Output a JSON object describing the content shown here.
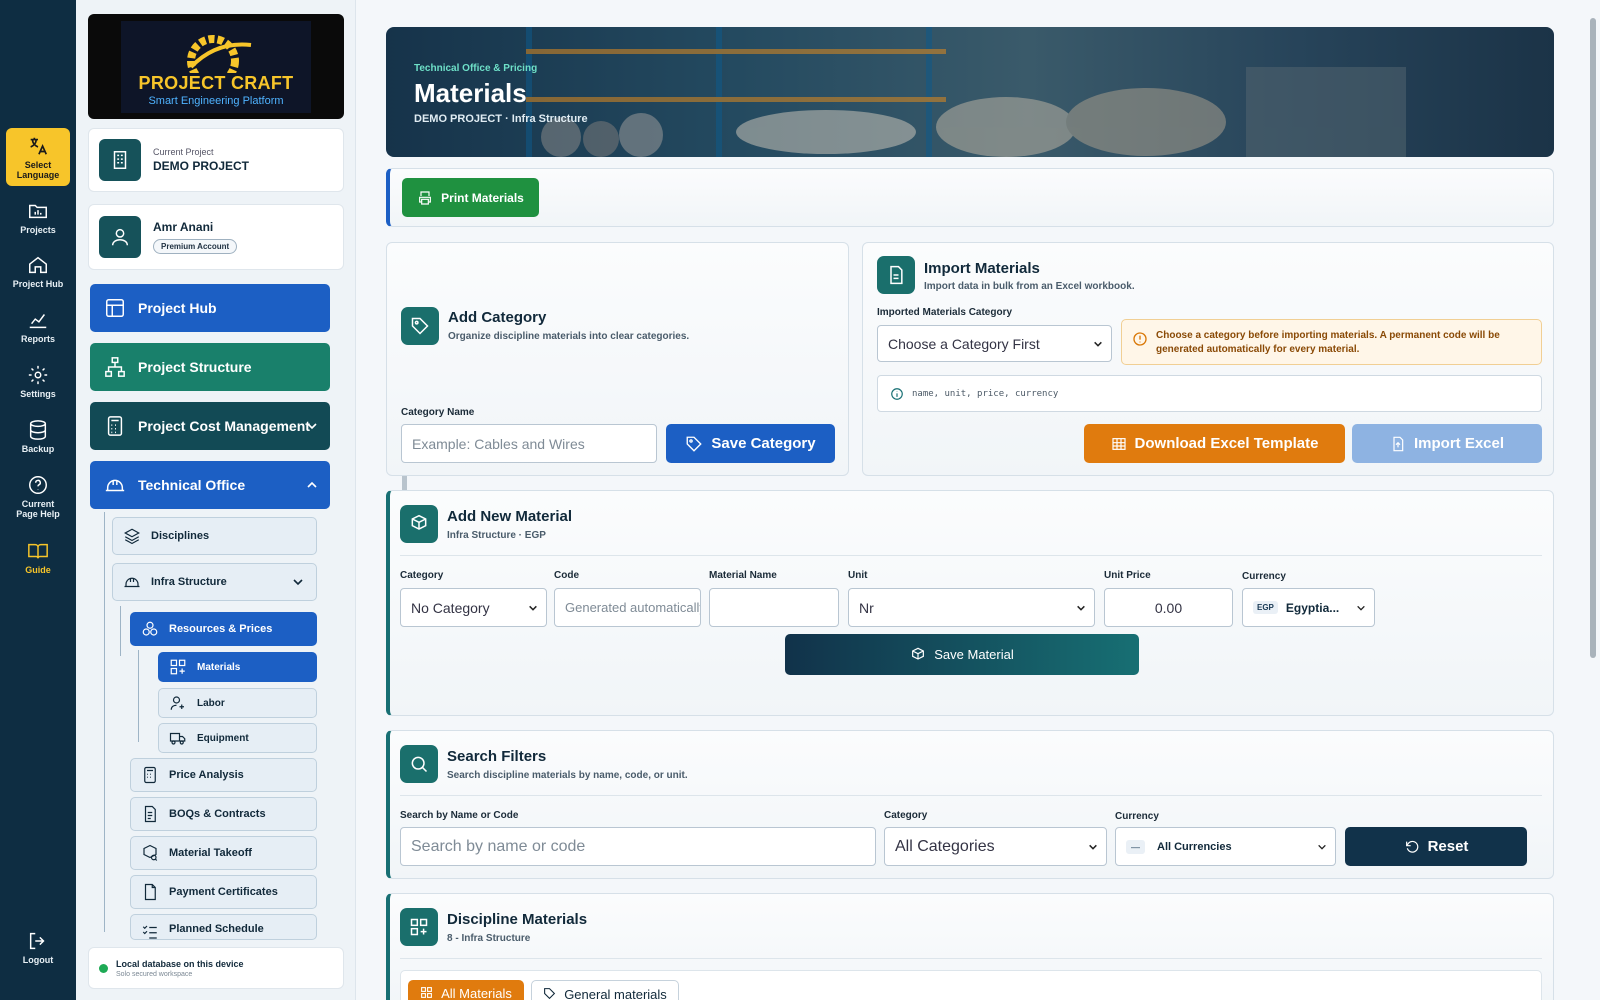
{
  "rail": {
    "language": "Select Language",
    "projects": "Projects",
    "project_hub": "Project Hub",
    "reports": "Reports",
    "settings": "Settings",
    "backup": "Backup",
    "help": "Current Page Help",
    "guide": "Guide",
    "logout": "Logout"
  },
  "logo": {
    "title": "PROJECT CRAFT",
    "subtitle": "Smart Engineering Platform"
  },
  "project_card": {
    "label": "Current Project",
    "name": "DEMO PROJECT"
  },
  "user_card": {
    "name": "Amr Anani",
    "badge": "Premium Account"
  },
  "nav": {
    "project_hub": "Project Hub",
    "project_structure": "Project Structure",
    "cost_management": "Project Cost Management",
    "technical_office": "Technical Office",
    "disciplines": "Disciplines",
    "infra_structure": "Infra Structure",
    "resources_prices": "Resources & Prices",
    "materials": "Materials",
    "labor": "Labor",
    "equipment": "Equipment",
    "price_analysis": "Price Analysis",
    "boqs": "BOQs & Contracts",
    "takeoff": "Material Takeoff",
    "payment": "Payment Certificates",
    "schedule": "Planned Schedule"
  },
  "db": {
    "title": "Local database on this device",
    "subtitle": "Solo secured workspace"
  },
  "hero": {
    "eyebrow": "Technical Office & Pricing",
    "title": "Materials",
    "meta": "DEMO PROJECT · Infra Structure"
  },
  "toolbar": {
    "print": "Print Materials"
  },
  "add_category": {
    "title": "Add Category",
    "subtitle": "Organize discipline materials into clear categories.",
    "field_label": "Category Name",
    "placeholder": "Example: Cables and Wires",
    "save": "Save Category"
  },
  "import": {
    "title": "Import Materials",
    "subtitle": "Import data in bulk from an Excel workbook.",
    "category_label": "Imported Materials Category",
    "category_value": "Choose a Category First",
    "warning": "Choose a category before importing materials. A permanent code will be generated automatically for every material.",
    "columns_hint": "name, unit, price, currency",
    "download": "Download Excel Template",
    "import_btn": "Import Excel"
  },
  "new_material": {
    "title": "Add New Material",
    "subtitle": "Infra Structure · EGP",
    "category_label": "Category",
    "category_value": "No Category",
    "code_label": "Code",
    "code_placeholder": "Generated automatically",
    "name_label": "Material Name",
    "unit_label": "Unit",
    "unit_value": "Nr",
    "price_label": "Unit Price",
    "price_value": "0.00",
    "currency_label": "Currency",
    "currency_code": "EGP",
    "currency_name": "Egyptia...",
    "save": "Save Material"
  },
  "filters": {
    "title": "Search Filters",
    "subtitle": "Search discipline materials by name, code, or unit.",
    "search_label": "Search by Name or Code",
    "search_placeholder": "Search by name or code",
    "category_label": "Category",
    "category_value": "All Categories",
    "currency_label": "Currency",
    "currency_dash": "—",
    "currency_value": "All Currencies",
    "reset": "Reset"
  },
  "list": {
    "title": "Discipline Materials",
    "subtitle": "8 - Infra Structure",
    "tab_all": "All Materials",
    "tab_general": "General materials"
  },
  "colors": {
    "rail": "#0e2d42",
    "accent_blue": "#1c5fc4",
    "teal": "#1a6f6c",
    "orange": "#e07b0e",
    "green": "#1f9140"
  }
}
